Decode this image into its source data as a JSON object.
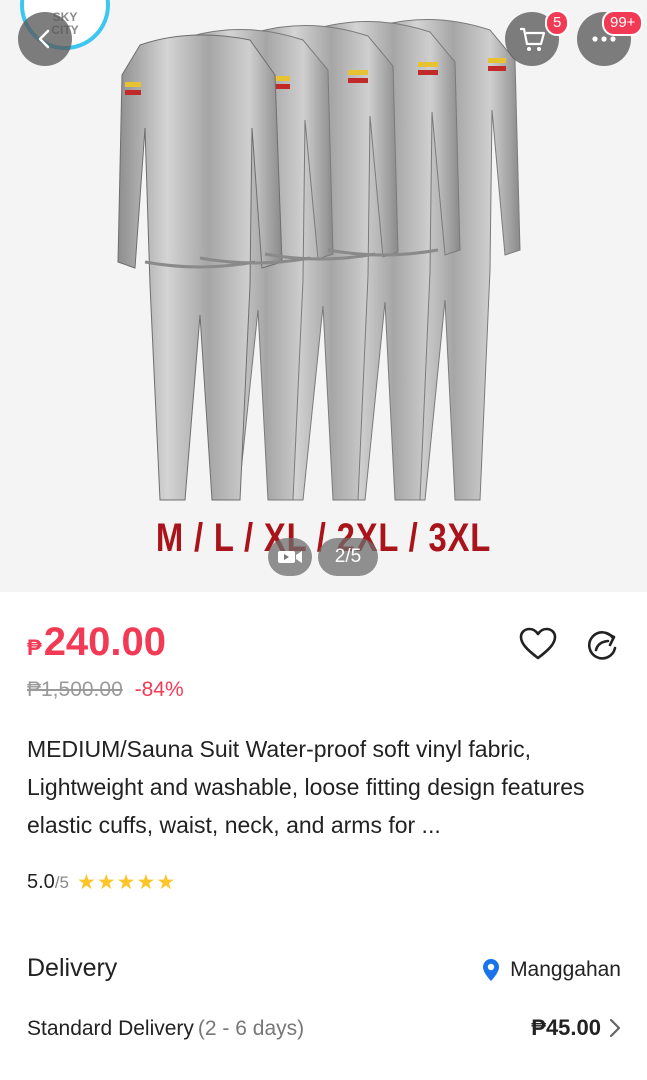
{
  "gallery": {
    "size_caption": "M / L  / XL / 2XL / 3XL",
    "logo_line1": "SKY",
    "logo_line2": "CITY",
    "counter": "2/5"
  },
  "header": {
    "cart_badge": "5",
    "more_badge": "99+"
  },
  "product": {
    "currency_symbol": "₱",
    "price": "240.00",
    "original_price": "₱1,500.00",
    "discount": "-84%",
    "title": "MEDIUM/Sauna Suit Water-proof soft vinyl fabric, Lightweight and washable, loose fitting design features elastic cuffs, waist, neck, and arms for ...",
    "rating_value": "5.0",
    "rating_max": "/5",
    "stars": 5
  },
  "delivery": {
    "heading": "Delivery",
    "location": "Manggahan",
    "option": "Standard Delivery",
    "days": "(2 - 6 days)",
    "fee": "₱45.00"
  },
  "colors": {
    "accent": "#f23a55",
    "star": "#fdc528",
    "location_pin": "#1a73e8"
  }
}
